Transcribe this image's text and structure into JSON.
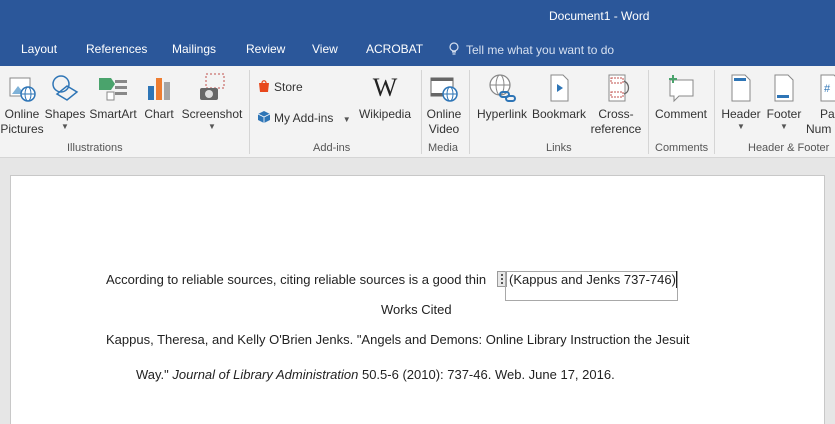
{
  "titlebar": {
    "title": "Document1 - Word"
  },
  "tabs": {
    "items": [
      "Layout",
      "References",
      "Mailings",
      "Review",
      "View",
      "ACROBAT"
    ],
    "tell_me": "Tell me what you want to do"
  },
  "ribbon": {
    "illustrations": {
      "online_pictures": [
        "Online",
        "Pictures"
      ],
      "shapes": "Shapes",
      "smartart": "SmartArt",
      "chart": "Chart",
      "screenshot": "Screenshot",
      "group_label": "Illustrations"
    },
    "addins": {
      "store": "Store",
      "my_addins": "My Add-ins",
      "wikipedia": "Wikipedia",
      "group_label": "Add-ins"
    },
    "media": {
      "online_video": [
        "Online",
        "Video"
      ],
      "group_label": "Media"
    },
    "links": {
      "hyperlink": "Hyperlink",
      "bookmark": "Bookmark",
      "cross_reference": [
        "Cross-",
        "reference"
      ],
      "group_label": "Links"
    },
    "comments": {
      "comment": "Comment",
      "group_label": "Comments"
    },
    "header_footer": {
      "header": "Header",
      "footer": "Footer",
      "page_number": [
        "Pag",
        "Num"
      ],
      "group_label": "Header & Footer"
    }
  },
  "document": {
    "sentence": "According to reliable sources, citing reliable sources is a good thin",
    "citation": "(Kappus and Jenks 737-746)",
    "works_cited_heading": "Works Cited",
    "reference_line1": "Kappus, Theresa, and Kelly O'Brien Jenks. \"Angels and Demons: Online Library Instruction the Jesuit",
    "reference_line2_start": "Way.\"",
    "reference_journal": "Journal of Library Administration",
    "reference_line2_end": "50.5-6 (2010): 737-46. Web. June 17, 2016."
  },
  "colors": {
    "title_bar": "#2b579a",
    "ribbon_bg": "#f3f3f3",
    "doc_bg": "#e6e6e6",
    "page_bg": "#ffffff"
  }
}
